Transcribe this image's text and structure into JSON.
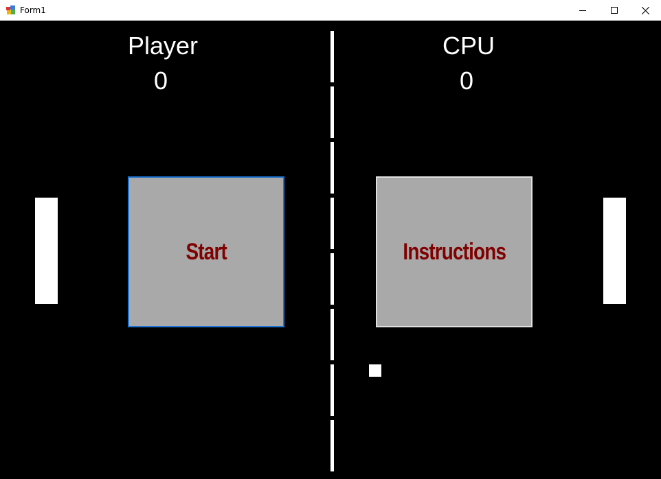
{
  "window": {
    "title": "Form1"
  },
  "scoreboard": {
    "player_label": "Player",
    "player_score": "0",
    "cpu_label": "CPU",
    "cpu_score": "0"
  },
  "menu": {
    "start_label": "Start",
    "instructions_label": "Instructions"
  },
  "colors": {
    "background": "#000000",
    "foreground": "#ffffff",
    "button_face": "#a9a9a9",
    "button_text": "#800000",
    "focus_border": "#1c74d4"
  },
  "icons": {
    "app": "app-icon",
    "minimize": "minimize-icon",
    "maximize": "maximize-icon",
    "close": "close-icon"
  }
}
